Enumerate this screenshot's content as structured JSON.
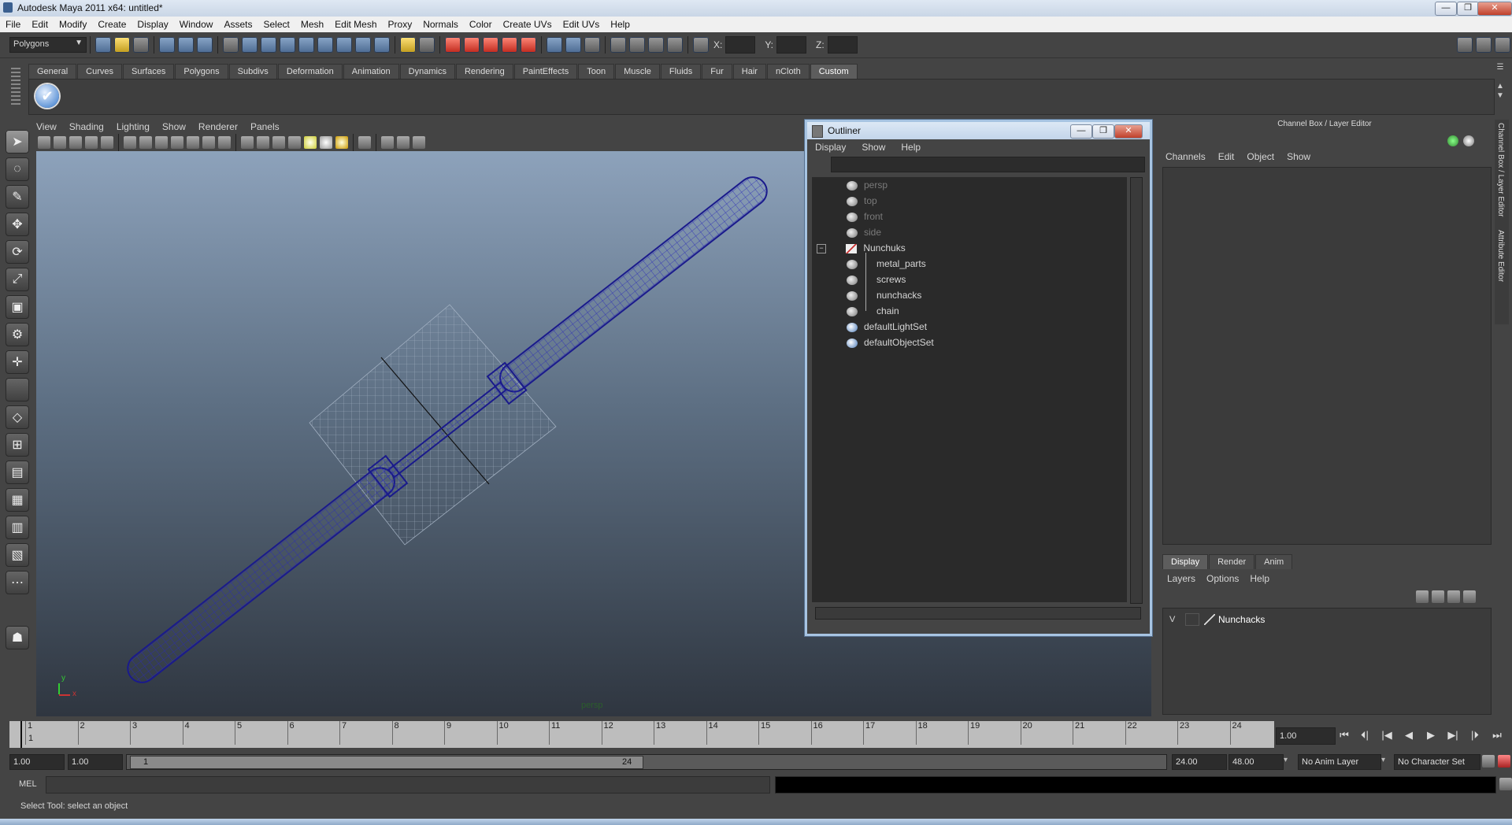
{
  "window": {
    "title": "Autodesk Maya 2011 x64: untitled*",
    "min": "—",
    "max": "❐",
    "close": "✕"
  },
  "menubar": [
    "File",
    "Edit",
    "Modify",
    "Create",
    "Display",
    "Window",
    "Assets",
    "Select",
    "Mesh",
    "Edit Mesh",
    "Proxy",
    "Normals",
    "Color",
    "Create UVs",
    "Edit UVs",
    "Help"
  ],
  "statusline": {
    "mode": "Polygons",
    "x_label": "X:",
    "y_label": "Y:",
    "z_label": "Z:"
  },
  "shelf": {
    "tabs": [
      "General",
      "Curves",
      "Surfaces",
      "Polygons",
      "Subdivs",
      "Deformation",
      "Animation",
      "Dynamics",
      "Rendering",
      "PaintEffects",
      "Toon",
      "Muscle",
      "Fluids",
      "Fur",
      "Hair",
      "nCloth",
      "Custom"
    ],
    "active": "Custom"
  },
  "viewport": {
    "menu": [
      "View",
      "Shading",
      "Lighting",
      "Show",
      "Renderer",
      "Panels"
    ],
    "camera_label": "persp",
    "axis_x": "x",
    "axis_y": "y"
  },
  "outliner": {
    "title": "Outliner",
    "menu": [
      "Display",
      "Show",
      "Help"
    ],
    "collapse": "−",
    "items": [
      {
        "label": "persp",
        "dim": true
      },
      {
        "label": "top",
        "dim": true
      },
      {
        "label": "front",
        "dim": true
      },
      {
        "label": "side",
        "dim": true
      },
      {
        "label": "Nunchuks",
        "dim": false
      },
      {
        "label": "metal_parts",
        "dim": false
      },
      {
        "label": "screws",
        "dim": false
      },
      {
        "label": "nunchacks",
        "dim": false
      },
      {
        "label": "chain",
        "dim": false
      },
      {
        "label": "defaultLightSet",
        "dim": false
      },
      {
        "label": "defaultObjectSet",
        "dim": false
      }
    ]
  },
  "channelbox": {
    "title": "Channel Box / Layer Editor",
    "menu": [
      "Channels",
      "Edit",
      "Object",
      "Show"
    ]
  },
  "layereditor": {
    "tabs": [
      "Display",
      "Render",
      "Anim"
    ],
    "active": "Display",
    "menu": [
      "Layers",
      "Options",
      "Help"
    ],
    "layer": {
      "visible": "V",
      "name": "Nunchacks"
    }
  },
  "sidetabs": {
    "channel": "Channel Box / Layer Editor",
    "attr": "Attribute Editor"
  },
  "timeline": {
    "ticks": [
      "1",
      "2",
      "3",
      "4",
      "5",
      "6",
      "7",
      "8",
      "9",
      "10",
      "11",
      "12",
      "13",
      "14",
      "15",
      "16",
      "17",
      "18",
      "19",
      "20",
      "21",
      "22",
      "23",
      "24"
    ],
    "current_marker": "1",
    "current_frame": "1.00"
  },
  "playback": [
    "⏮",
    "⏴|",
    "|◀",
    "◀",
    "▶",
    "▶|",
    "|⏵",
    "⏭"
  ],
  "range": {
    "start": "1.00",
    "anim_start": "1.00",
    "slider_start": "1",
    "slider_end": "24",
    "end": "24.00",
    "anim_end": "48.00",
    "anim_layer": "No Anim Layer",
    "char_set": "No Character Set"
  },
  "command": {
    "label": "MEL"
  },
  "help": {
    "text": "Select Tool: select an object"
  },
  "colors": {
    "accent": "#a7c4e2",
    "mesh": "#1a1a8c"
  }
}
